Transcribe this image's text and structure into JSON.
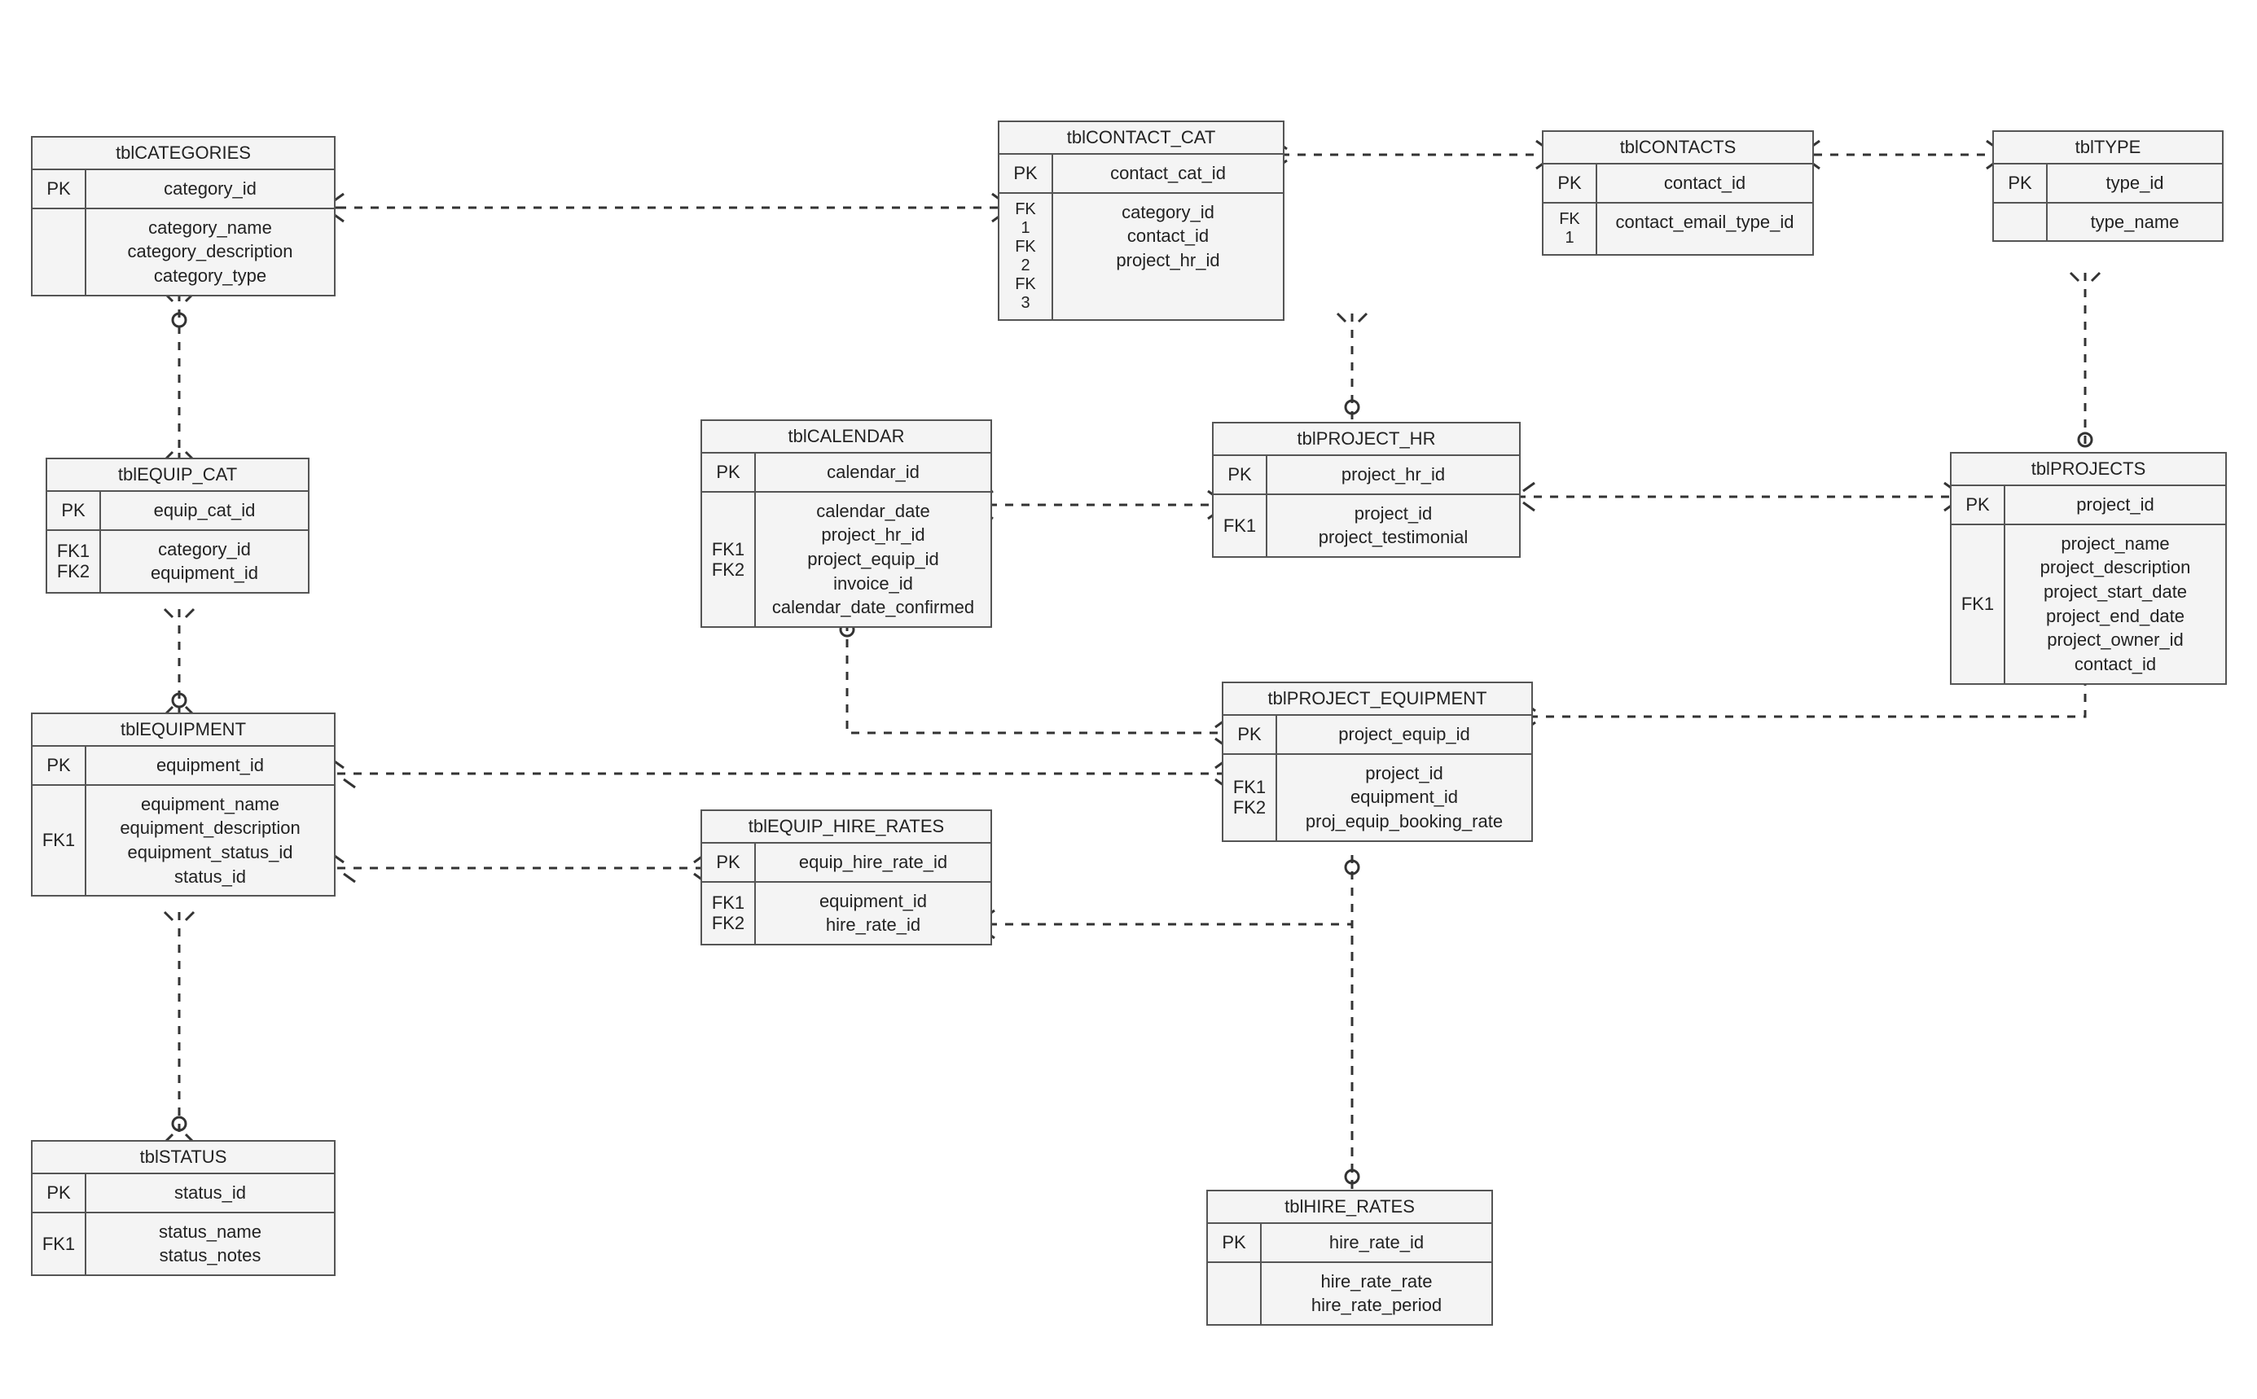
{
  "entities": {
    "categories": {
      "title": "tblCATEGORIES",
      "pk_key": "PK",
      "pk_val": "category_id",
      "attr_key": "",
      "attr_val": "category_name\ncategory_description\ncategory_type"
    },
    "equip_cat": {
      "title": "tblEQUIP_CAT",
      "pk_key": "PK",
      "pk_val": "equip_cat_id",
      "attr_key": "FK1\nFK2",
      "attr_val": "category_id\nequipment_id"
    },
    "equipment": {
      "title": "tblEQUIPMENT",
      "pk_key": "PK",
      "pk_val": "equipment_id",
      "attr_key": "FK1",
      "attr_val": "equipment_name\nequipment_description\nequipment_status_id\nstatus_id"
    },
    "status": {
      "title": "tblSTATUS",
      "pk_key": "PK",
      "pk_val": "status_id",
      "attr_key": "FK1",
      "attr_val": "status_name\nstatus_notes"
    },
    "contact_cat": {
      "title": "tblCONTACT_CAT",
      "pk_key": "PK",
      "pk_val": "contact_cat_id",
      "attr_key": "FK\n1\nFK\n2\nFK\n3",
      "attr_val": "category_id\ncontact_id\nproject_hr_id"
    },
    "calendar": {
      "title": "tblCALENDAR",
      "pk_key": "PK",
      "pk_val": "calendar_id",
      "attr_key": "FK1\nFK2",
      "attr_val": "calendar_date\nproject_hr_id\nproject_equip_id\ninvoice_id\ncalendar_date_confirmed"
    },
    "project_hr": {
      "title": "tblPROJECT_HR",
      "pk_key": "PK",
      "pk_val": "project_hr_id",
      "attr_key": "FK1",
      "attr_val": "project_id\nproject_testimonial"
    },
    "project_equipment": {
      "title": "tblPROJECT_EQUIPMENT",
      "pk_key": "PK",
      "pk_val": "project_equip_id",
      "attr_key": "FK1\nFK2",
      "attr_val": "project_id\nequipment_id\nproj_equip_booking_rate"
    },
    "equip_hire_rates": {
      "title": "tblEQUIP_HIRE_RATES",
      "pk_key": "PK",
      "pk_val": "equip_hire_rate_id",
      "attr_key": "FK1\nFK2",
      "attr_val": "equipment_id\nhire_rate_id"
    },
    "hire_rates": {
      "title": "tblHIRE_RATES",
      "pk_key": "PK",
      "pk_val": "hire_rate_id",
      "attr_key": "",
      "attr_val": "hire_rate_rate\nhire_rate_period"
    },
    "contacts": {
      "title": "tblCONTACTS",
      "pk_key": "PK",
      "pk_val": "contact_id",
      "attr_key": "FK\n1",
      "attr_val": "contact_email_type_id"
    },
    "type": {
      "title": "tblTYPE",
      "pk_key": "PK",
      "pk_val": "type_id",
      "attr_key": "",
      "attr_val": "type_name"
    },
    "projects": {
      "title": "tblPROJECTS",
      "pk_key": "PK",
      "pk_val": "project_id",
      "attr_key": "FK1",
      "attr_val": "project_name\nproject_description\nproject_start_date\nproject_end_date\nproject_owner_id\ncontact_id"
    }
  },
  "chart_data": {
    "type": "entity-relationship-diagram",
    "entities": [
      {
        "name": "tblCATEGORIES",
        "pk": [
          "category_id"
        ],
        "attrs": [
          "category_name",
          "category_description",
          "category_type"
        ]
      },
      {
        "name": "tblEQUIP_CAT",
        "pk": [
          "equip_cat_id"
        ],
        "fks": [
          "FK1",
          "FK2"
        ],
        "attrs": [
          "category_id",
          "equipment_id"
        ]
      },
      {
        "name": "tblEQUIPMENT",
        "pk": [
          "equipment_id"
        ],
        "fks": [
          "FK1"
        ],
        "attrs": [
          "equipment_name",
          "equipment_description",
          "equipment_status_id",
          "status_id"
        ]
      },
      {
        "name": "tblSTATUS",
        "pk": [
          "status_id"
        ],
        "fks": [
          "FK1"
        ],
        "attrs": [
          "status_name",
          "status_notes"
        ]
      },
      {
        "name": "tblCONTACT_CAT",
        "pk": [
          "contact_cat_id"
        ],
        "fks": [
          "FK1",
          "FK2",
          "FK3"
        ],
        "attrs": [
          "category_id",
          "contact_id",
          "project_hr_id"
        ]
      },
      {
        "name": "tblCALENDAR",
        "pk": [
          "calendar_id"
        ],
        "fks": [
          "FK1",
          "FK2"
        ],
        "attrs": [
          "calendar_date",
          "project_hr_id",
          "project_equip_id",
          "invoice_id",
          "calendar_date_confirmed"
        ]
      },
      {
        "name": "tblPROJECT_HR",
        "pk": [
          "project_hr_id"
        ],
        "fks": [
          "FK1"
        ],
        "attrs": [
          "project_id",
          "project_testimonial"
        ]
      },
      {
        "name": "tblPROJECT_EQUIPMENT",
        "pk": [
          "project_equip_id"
        ],
        "fks": [
          "FK1",
          "FK2"
        ],
        "attrs": [
          "project_id",
          "equipment_id",
          "proj_equip_booking_rate"
        ]
      },
      {
        "name": "tblEQUIP_HIRE_RATES",
        "pk": [
          "equip_hire_rate_id"
        ],
        "fks": [
          "FK1",
          "FK2"
        ],
        "attrs": [
          "equipment_id",
          "hire_rate_id"
        ]
      },
      {
        "name": "tblHIRE_RATES",
        "pk": [
          "hire_rate_id"
        ],
        "attrs": [
          "hire_rate_rate",
          "hire_rate_period"
        ]
      },
      {
        "name": "tblCONTACTS",
        "pk": [
          "contact_id"
        ],
        "fks": [
          "FK1"
        ],
        "attrs": [
          "contact_email_type_id"
        ]
      },
      {
        "name": "tblTYPE",
        "pk": [
          "type_id"
        ],
        "attrs": [
          "type_name"
        ]
      },
      {
        "name": "tblPROJECTS",
        "pk": [
          "project_id"
        ],
        "fks": [
          "FK1"
        ],
        "attrs": [
          "project_name",
          "project_description",
          "project_start_date",
          "project_end_date",
          "project_owner_id",
          "contact_id"
        ]
      }
    ],
    "relationships": [
      {
        "from": "tblCATEGORIES",
        "to": "tblEQUIP_CAT"
      },
      {
        "from": "tblCATEGORIES",
        "to": "tblCONTACT_CAT"
      },
      {
        "from": "tblEQUIP_CAT",
        "to": "tblEQUIPMENT"
      },
      {
        "from": "tblEQUIPMENT",
        "to": "tblSTATUS"
      },
      {
        "from": "tblEQUIPMENT",
        "to": "tblEQUIP_HIRE_RATES"
      },
      {
        "from": "tblEQUIPMENT",
        "to": "tblPROJECT_EQUIPMENT"
      },
      {
        "from": "tblCONTACT_CAT",
        "to": "tblCONTACTS"
      },
      {
        "from": "tblCONTACT_CAT",
        "to": "tblPROJECT_HR"
      },
      {
        "from": "tblCONTACTS",
        "to": "tblTYPE"
      },
      {
        "from": "tblCALENDAR",
        "to": "tblPROJECT_HR"
      },
      {
        "from": "tblCALENDAR",
        "to": "tblPROJECT_EQUIPMENT"
      },
      {
        "from": "tblPROJECT_HR",
        "to": "tblPROJECTS"
      },
      {
        "from": "tblPROJECT_EQUIPMENT",
        "to": "tblPROJECTS"
      },
      {
        "from": "tblEQUIP_HIRE_RATES",
        "to": "tblHIRE_RATES"
      },
      {
        "from": "tblTYPE",
        "to": "tblPROJECTS"
      },
      {
        "from": "tblPROJECT_EQUIPMENT",
        "to": "tblHIRE_RATES"
      }
    ]
  }
}
